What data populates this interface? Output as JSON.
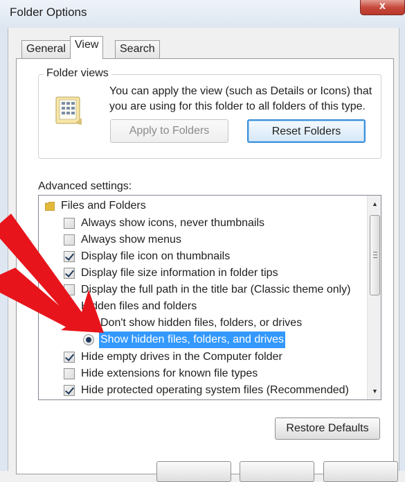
{
  "window": {
    "title": "Folder Options",
    "close_label": "x"
  },
  "tabs": [
    {
      "label": "General",
      "active": false
    },
    {
      "label": "View",
      "active": true
    },
    {
      "label": "Search",
      "active": false
    }
  ],
  "folder_views": {
    "label": "Folder views",
    "description": "You can apply the view (such as Details or Icons) that you are using for this folder to all folders of this type.",
    "apply_button": "Apply to Folders",
    "reset_button": "Reset Folders"
  },
  "advanced": {
    "label": "Advanced settings:",
    "items": [
      {
        "type": "folder",
        "label": "Files and Folders"
      },
      {
        "type": "checkbox",
        "label": "Always show icons, never thumbnails",
        "checked": false
      },
      {
        "type": "checkbox",
        "label": "Always show menus",
        "checked": false
      },
      {
        "type": "checkbox",
        "label": "Display file icon on thumbnails",
        "checked": true
      },
      {
        "type": "checkbox",
        "label": "Display file size information in folder tips",
        "checked": true
      },
      {
        "type": "checkbox",
        "label": "Display the full path in the title bar (Classic theme only)",
        "checked": false
      },
      {
        "type": "group",
        "label": "Hidden files and folders"
      },
      {
        "type": "radio",
        "label": "Don't show hidden files, folders, or drives",
        "checked": false
      },
      {
        "type": "radio",
        "label": "Show hidden files, folders, and drives",
        "checked": true,
        "selected": true
      },
      {
        "type": "checkbox",
        "label": "Hide empty drives in the Computer folder",
        "checked": true
      },
      {
        "type": "checkbox",
        "label": "Hide extensions for known file types",
        "checked": false
      },
      {
        "type": "checkbox",
        "label": "Hide protected operating system files (Recommended)",
        "checked": true
      }
    ]
  },
  "restore_button": "Restore Defaults",
  "colors": {
    "selection": "#3399ff",
    "arrow": "#e8141b",
    "default_button_border": "#3c8fd8"
  }
}
